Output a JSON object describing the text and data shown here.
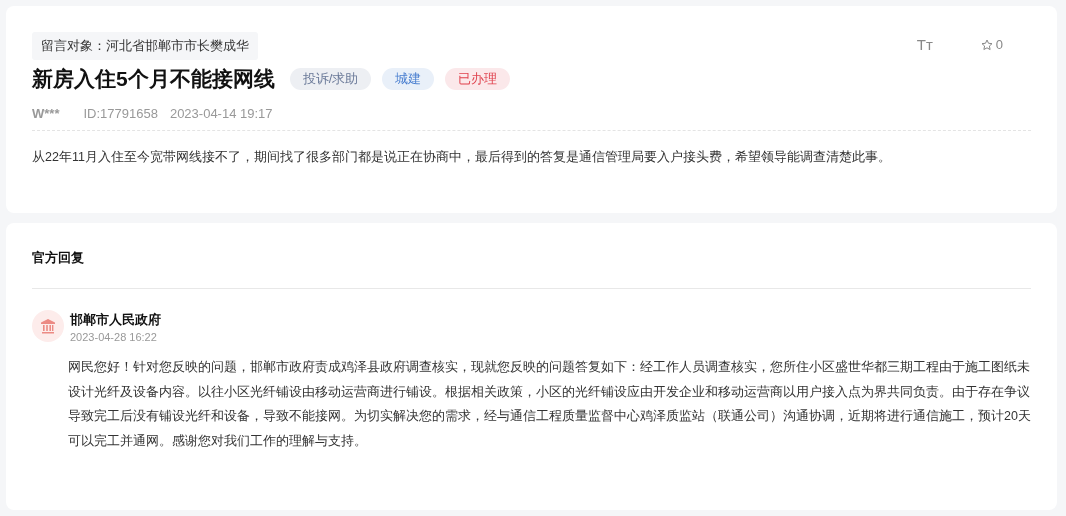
{
  "message": {
    "recipient": "留言对象：河北省邯郸市市长樊成华",
    "title": "新房入住5个月不能接网线",
    "tags": [
      {
        "label": "投诉/求助",
        "color": "#6b7a99"
      },
      {
        "label": "城建",
        "color": "#4a7fd0"
      },
      {
        "label": "已办理",
        "color": "#e0434f"
      }
    ],
    "font_size_button": "Tт",
    "favorites": "0",
    "author": "W***",
    "id": "ID:17791658",
    "time": "2023-04-14 19:17",
    "body": "从22年11月入住至今宽带网线接不了，期间找了很多部门都是说正在协商中，最后得到的答复是通信管理局要入户接头费，希望领导能调查清楚此事。"
  },
  "reply": {
    "heading": "官方回复",
    "org": "邯郸市人民政府",
    "time": "2023-04-28 16:22",
    "body": "网民您好！针对您反映的问题，邯郸市政府责成鸡泽县政府调查核实，现就您反映的问题答复如下：经工作人员调查核实，您所住小区盛世华都三期工程由于施工图纸未设计光纤及设备内容。以往小区光纤铺设由移动运营商进行铺设。根据相关政策，小区的光纤铺设应由开发企业和移动运营商以用户接入点为界共同负责。由于存在争议导致完工后没有铺设光纤和设备，导致不能接网。为切实解决您的需求，经与通信工程质量监督中心鸡泽质监站（联通公司）沟通协调，近期将进行通信施工，预计20天可以完工并通网。感谢您对我们工作的理解与支持。"
  }
}
